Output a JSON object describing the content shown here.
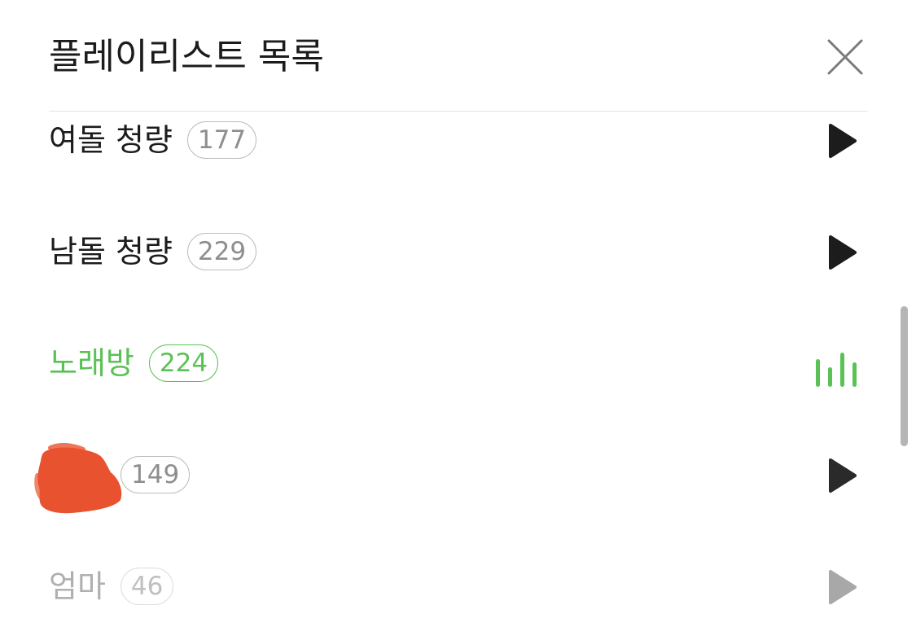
{
  "header": {
    "title": "플레이리스트 목록"
  },
  "playlists": [
    {
      "name": "여돌 청량",
      "count": "177",
      "state": "idle"
    },
    {
      "name": "남돌 청량",
      "count": "229",
      "state": "idle"
    },
    {
      "name": "노래방",
      "count": "224",
      "state": "playing"
    },
    {
      "name": "",
      "count": "149",
      "state": "idle",
      "redacted": true
    },
    {
      "name": "엄마",
      "count": "46",
      "state": "idle",
      "faded": true
    }
  ],
  "colors": {
    "accent": "#5ac255",
    "text": "#1c1c1c",
    "pill_border": "#bdbdbd",
    "pill_text": "#8e8e8e",
    "faded_text": "#b0b0b0",
    "redaction": "#e8522e"
  },
  "icons": {
    "close": "close-icon",
    "play": "play-icon",
    "now_playing": "equalizer-icon"
  }
}
